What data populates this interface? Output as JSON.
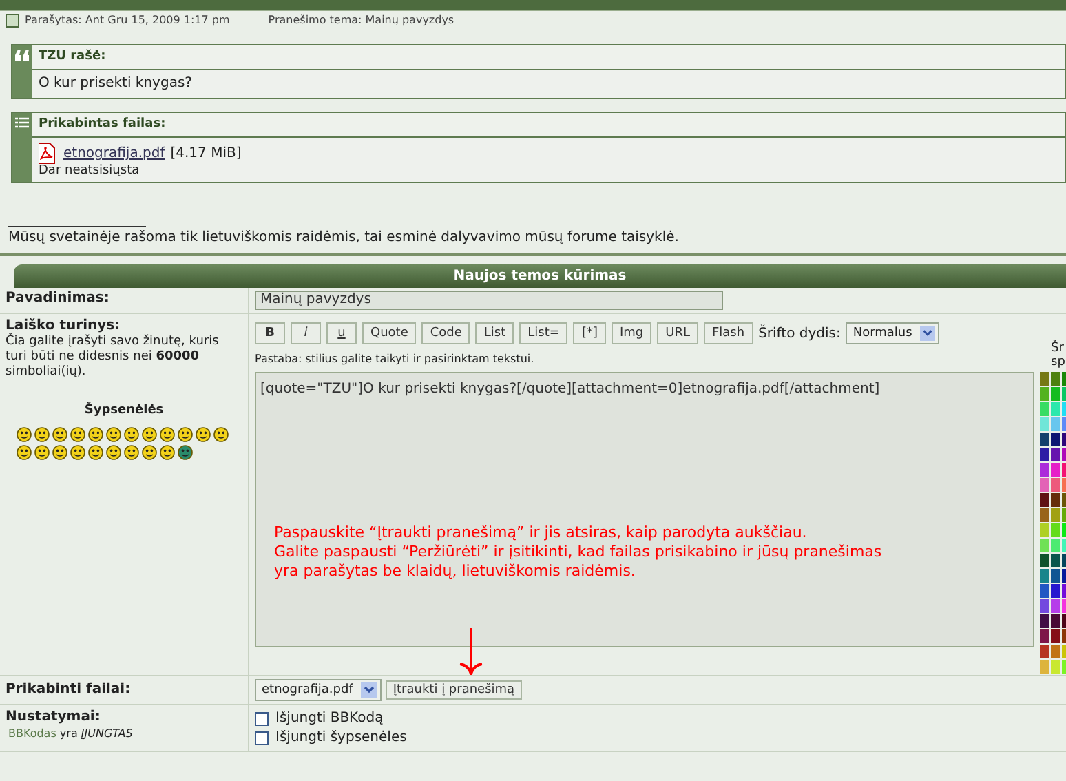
{
  "post_header": {
    "posted": "Parašytas: Ant Gru 15, 2009 1:17 pm",
    "subject": "Pranešimo tema: Mainų pavyzdys"
  },
  "quote": {
    "title": "TZU rašė:",
    "text": "O kur prisekti knygas?"
  },
  "attachment": {
    "title": "Prikabintas failas:",
    "file_name": "etnografija.pdf",
    "size": "[4.17 MiB]",
    "status": "Dar neatsisiųsta"
  },
  "signature": "Mūsų svetainėje rašoma tik lietuviškomis raidėmis, tai esminė dalyvavimo mūsų forume taisyklė.",
  "form": {
    "title": "Naujos temos kūrimas",
    "subject_label": "Pavadinimas:",
    "subject_value": "Mainų pavyzdys",
    "body_label": "Laiško turinys:",
    "body_hint": "Čia galite įrašyti savo žinutę, kuris turi būti ne didesnis nei **60000** simboliai(ių).",
    "smileys_label": "Šypsenėlės",
    "format_buttons": [
      {
        "label": "B",
        "kind": "bold"
      },
      {
        "label": "i",
        "kind": "italic"
      },
      {
        "label": "u",
        "kind": "underline"
      },
      {
        "label": "Quote",
        "kind": "plain"
      },
      {
        "label": "Code",
        "kind": "plain"
      },
      {
        "label": "List",
        "kind": "plain"
      },
      {
        "label": "List=",
        "kind": "plain"
      },
      {
        "label": "[*]",
        "kind": "plain"
      },
      {
        "label": "Img",
        "kind": "plain"
      },
      {
        "label": "URL",
        "kind": "plain"
      },
      {
        "label": "Flash",
        "kind": "plain"
      }
    ],
    "font_size_label": "Šrifto dydis:",
    "font_size": "Normalus",
    "tip": "Pastaba: stilius galite taikyti ir pasirinktam tekstui.",
    "body_value": "[quote=\"TZU\"]O kur prisekti knygas?[/quote][attachment=0]etnografija.pdf[/attachment]",
    "palette_label": [
      "Šr",
      "sp"
    ],
    "attach_label": "Prikabinti failai:",
    "attach_select": "etnografija.pdf",
    "attach_button": "Įtraukti į pranešimą",
    "options_label": "Nustatymai:",
    "bbcode_link": "BBKodas",
    "bbcode_state": "yra *ĮJUNGTAS*",
    "options": [
      {
        "label": "Išjungti BBKodą",
        "checked": false
      },
      {
        "label": "Išjungti šypsenėles",
        "checked": false
      }
    ]
  },
  "annotation": {
    "lines": [
      "Paspauskite “Įtraukti pranešimą” ir jis atsiras, kaip parodyta aukščiau.",
      "Galite paspausti “Peržiūrėti” ir įsitikinti, kad failas prisikabino ir jūsų pranešimas",
      "yra parašytas be klaidų, lietuviškomis raidėmis."
    ]
  }
}
